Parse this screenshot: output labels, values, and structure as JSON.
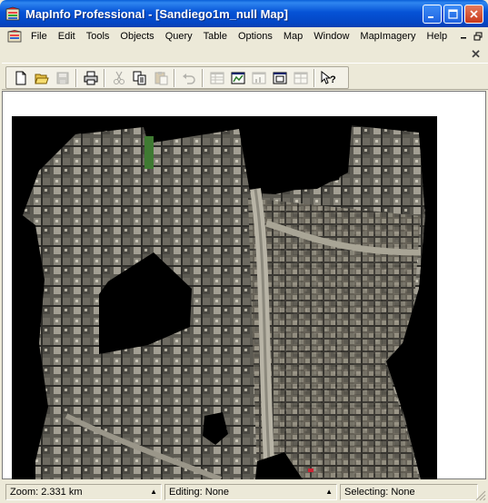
{
  "window": {
    "title": "MapInfo Professional - [Sandiego1m_null Map]",
    "title_color": "#0552d6"
  },
  "menubar": {
    "items": [
      {
        "label": "File"
      },
      {
        "label": "Edit"
      },
      {
        "label": "Tools"
      },
      {
        "label": "Objects"
      },
      {
        "label": "Query"
      },
      {
        "label": "Table"
      },
      {
        "label": "Options"
      },
      {
        "label": "Map"
      },
      {
        "label": "Window"
      },
      {
        "label": "MapImagery"
      },
      {
        "label": "Help"
      }
    ]
  },
  "toolbar": {
    "buttons": [
      {
        "name": "new-document",
        "icon": "new-document-icon",
        "enabled": true
      },
      {
        "name": "open",
        "icon": "open-folder-icon",
        "enabled": true
      },
      {
        "name": "save",
        "icon": "save-disk-icon",
        "enabled": false
      },
      {
        "name": "print",
        "icon": "printer-icon",
        "enabled": true
      },
      {
        "name": "cut",
        "icon": "scissors-icon",
        "enabled": false
      },
      {
        "name": "copy",
        "icon": "copy-icon",
        "enabled": true
      },
      {
        "name": "paste",
        "icon": "paste-icon",
        "enabled": false
      },
      {
        "name": "undo",
        "icon": "undo-icon",
        "enabled": false
      },
      {
        "name": "new-browser",
        "icon": "browser-window-icon",
        "enabled": false
      },
      {
        "name": "new-mapper",
        "icon": "map-window-icon",
        "enabled": true
      },
      {
        "name": "new-grapher",
        "icon": "graph-window-icon",
        "enabled": false
      },
      {
        "name": "new-layout",
        "icon": "layout-window-icon",
        "enabled": true
      },
      {
        "name": "redistrict",
        "icon": "redistrict-window-icon",
        "enabled": false
      },
      {
        "name": "help",
        "icon": "help-pointer-icon",
        "enabled": true
      }
    ]
  },
  "statusbar": {
    "zoom": "Zoom: 2.331 km",
    "editing": "Editing: None",
    "selecting": "Selecting: None"
  }
}
